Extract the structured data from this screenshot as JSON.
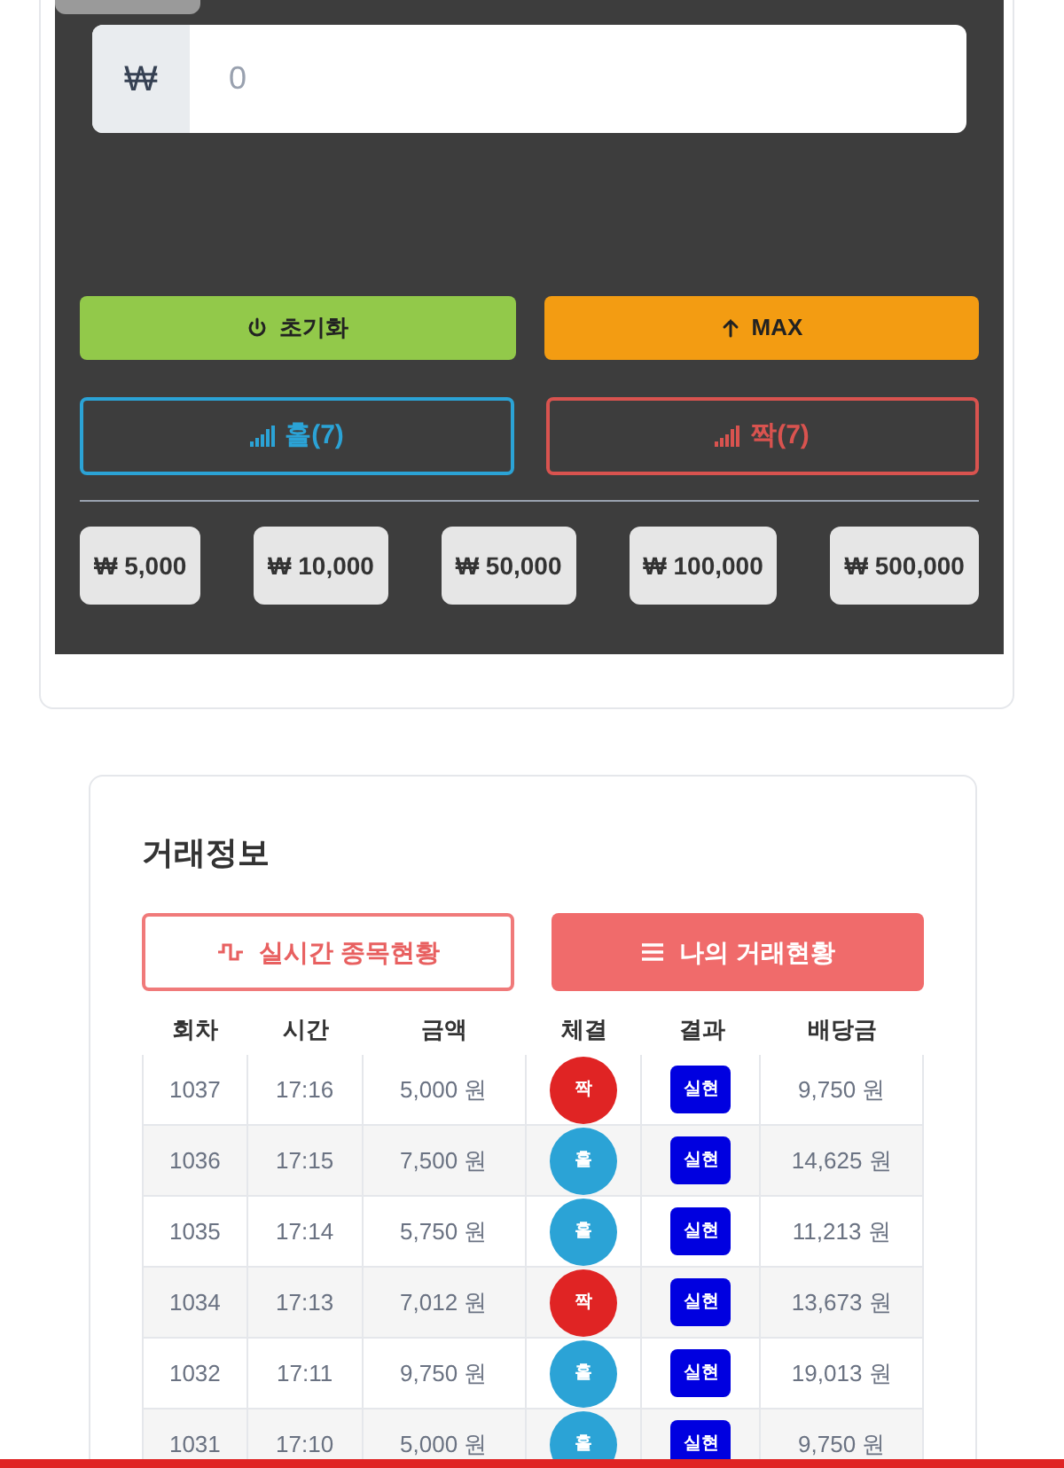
{
  "amount_field": {
    "currency": "₩",
    "value": "0"
  },
  "action_buttons": [
    {
      "kind": "reset",
      "label": "초기화"
    },
    {
      "kind": "max",
      "label": "MAX"
    }
  ],
  "bet_buttons": [
    {
      "label": "홀(7)",
      "color": "#2ba3d6"
    },
    {
      "label": "짝(7)",
      "color": "#d9534f"
    }
  ],
  "chips": [
    "₩ 5,000",
    "₩ 10,000",
    "₩ 50,000",
    "₩ 100,000",
    "₩ 500,000"
  ],
  "trade_info": {
    "title": "거래정보",
    "tabs": [
      {
        "kind": "live",
        "label": "실시간 종목현황",
        "selected": false
      },
      {
        "kind": "mine",
        "label": "나의 거래현황",
        "selected": true
      }
    ],
    "columns": [
      "회차",
      "시간",
      "금액",
      "체결",
      "결과",
      "배당금"
    ],
    "rows": [
      {
        "round": "1037",
        "time": "17:16",
        "amount": "5,000 원",
        "bet": "짝",
        "color": "#e02424",
        "result": "실현",
        "payout": "9,750 원"
      },
      {
        "round": "1036",
        "time": "17:15",
        "amount": "7,500 원",
        "bet": "홀",
        "color": "#2ba3d6",
        "result": "실현",
        "payout": "14,625 원"
      },
      {
        "round": "1035",
        "time": "17:14",
        "amount": "5,750 원",
        "bet": "홀",
        "color": "#2ba3d6",
        "result": "실현",
        "payout": "11,213 원"
      },
      {
        "round": "1034",
        "time": "17:13",
        "amount": "7,012 원",
        "bet": "짝",
        "color": "#e02424",
        "result": "실현",
        "payout": "13,673 원"
      },
      {
        "round": "1032",
        "time": "17:11",
        "amount": "9,750 원",
        "bet": "홀",
        "color": "#2ba3d6",
        "result": "실현",
        "payout": "19,013 원"
      },
      {
        "round": "1031",
        "time": "17:10",
        "amount": "5,000 원",
        "bet": "홀",
        "color": "#2ba3d6",
        "result": "실현",
        "payout": "9,750 원"
      }
    ]
  }
}
